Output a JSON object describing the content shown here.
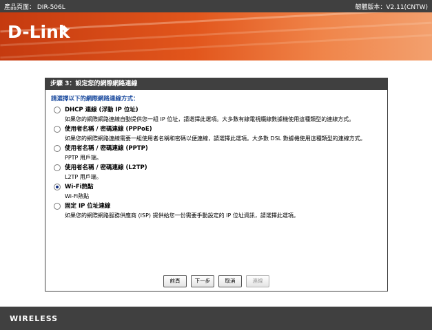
{
  "topbar": {
    "product": "產品頁面： DIR-506L",
    "firmware": "韌體版本：V2.11(CNTW)"
  },
  "brand": {
    "logo": "D-Link"
  },
  "panel": {
    "title": "步驟 3：設定您的網際網路連線",
    "instruction": "請選擇以下的網際網路連線方式：",
    "options": [
      {
        "label": "DHCP 連線 (浮動 IP 位址)",
        "description": "如果您的網際網路連線自動提供您一組 IP 位址，請選擇此選項。大多數有線電視纜線數據機使用這種類型的連線方式。",
        "checked": false
      },
      {
        "label": "使用者名稱 / 密碼連線 (PPPoE)",
        "description": "如果您的網際網路連線需要一組使用者名稱和密碼以便連線，請選擇此選項。大多數 DSL 數據機使用這種類型的連線方式。",
        "checked": false
      },
      {
        "label": "使用者名稱 / 密碼連線 (PPTP)",
        "description": "PPTP 用戶端。",
        "checked": false
      },
      {
        "label": "使用者名稱 / 密碼連線 (L2TP)",
        "description": "L2TP 用戶端。",
        "checked": false
      },
      {
        "label": "Wi-Fi熱點",
        "description": "Wi-Fi熱點",
        "checked": true
      },
      {
        "label": "固定 IP 位址連線",
        "description": "如果您的網際網路服務供應商 (ISP) 提供給您一份需要手動設定的 IP 位址資訊，請選擇此選項。",
        "checked": false
      }
    ],
    "buttons": {
      "prev": "前頁",
      "next": "下一步",
      "cancel": "取消",
      "connect": "連線"
    }
  },
  "footer": {
    "text": "WIRELESS"
  }
}
